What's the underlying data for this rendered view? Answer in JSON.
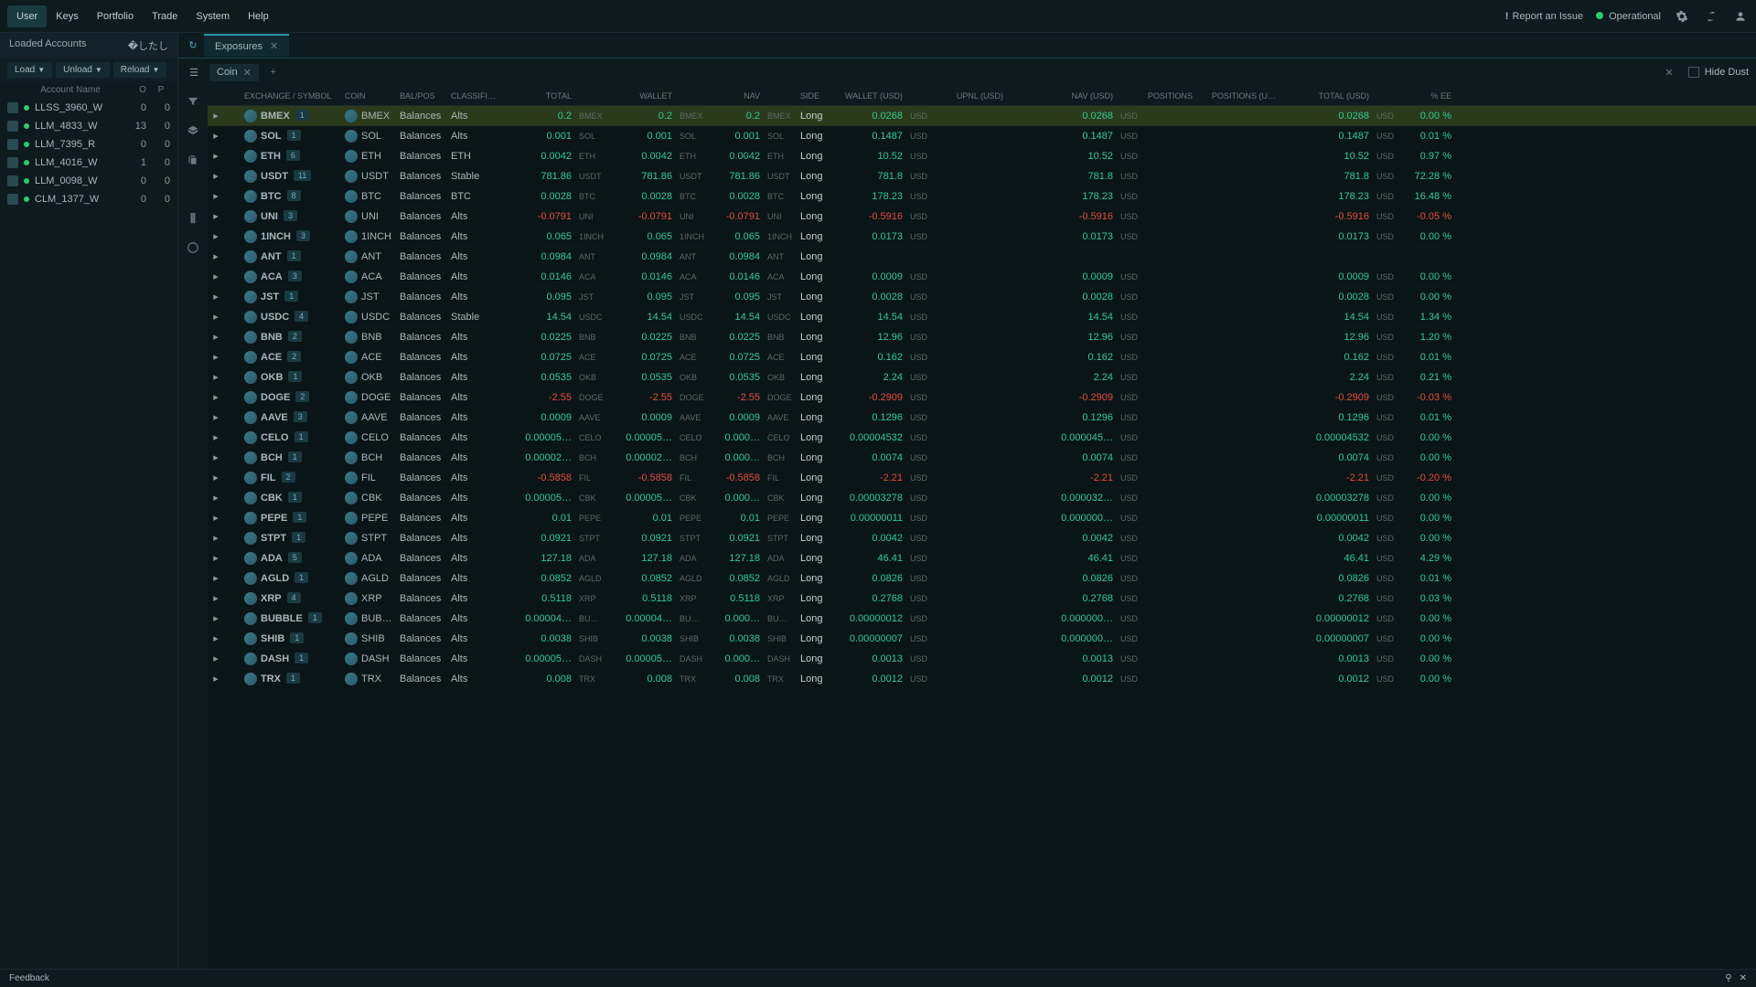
{
  "menu": {
    "items": [
      "User",
      "Keys",
      "Portfolio",
      "Trade",
      "System",
      "Help"
    ],
    "active": 0
  },
  "topbar": {
    "report": "Report an Issue",
    "status": "Operational"
  },
  "sidebar": {
    "title": "Loaded Accounts",
    "tools": [
      "Load",
      "Unload",
      "Reload"
    ],
    "cols": {
      "name": "Account Name",
      "o": "O",
      "p": "P"
    },
    "accounts": [
      {
        "name": "LLSS_3960_W",
        "o": 0,
        "p": 0
      },
      {
        "name": "LLM_4833_W",
        "o": 13,
        "p": 0
      },
      {
        "name": "LLM_7395_R",
        "o": 0,
        "p": 0
      },
      {
        "name": "LLM_4016_W",
        "o": 1,
        "p": 0
      },
      {
        "name": "LLM_0098_W",
        "o": 0,
        "p": 0
      },
      {
        "name": "CLM_1377_W",
        "o": 0,
        "p": 0
      }
    ]
  },
  "tab": {
    "name": "Exposures"
  },
  "filter": {
    "chip": "Coin",
    "hideDust": "Hide Dust"
  },
  "headers": [
    "",
    "",
    "EXCHANGE / SYMBOL",
    "COIN",
    "BAL/POS",
    "CLASSIFICATION",
    "TOTAL",
    "",
    "WALLET",
    "",
    "NAV",
    "",
    "SIDE",
    "WALLET (USD)",
    "",
    "UPNL (USD)",
    "",
    "NAV (USD)",
    "",
    "POSITIONS",
    "POSITIONS (USD)",
    "TOTAL (USD)",
    "",
    "% EE"
  ],
  "rows": [
    {
      "sym": "BMEX",
      "cnt": 1,
      "bal": "Balances",
      "cls": "Alts",
      "tot": "0.2",
      "wal": "0.2",
      "nav": "0.2",
      "side": "Long",
      "wusd": "0.0268",
      "navusd": "0.0268",
      "tusd": "0.0268",
      "ee": "0.00 %",
      "u": "BMEX",
      "sel": true
    },
    {
      "sym": "SOL",
      "cnt": 1,
      "bal": "Balances",
      "cls": "Alts",
      "tot": "0.001",
      "wal": "0.001",
      "nav": "0.001",
      "side": "Long",
      "wusd": "0.1487",
      "navusd": "0.1487",
      "tusd": "0.1487",
      "ee": "0.01 %",
      "u": "SOL"
    },
    {
      "sym": "ETH",
      "cnt": 6,
      "bal": "Balances",
      "cls": "ETH",
      "tot": "0.0042",
      "wal": "0.0042",
      "nav": "0.0042",
      "side": "Long",
      "wusd": "10.52",
      "navusd": "10.52",
      "tusd": "10.52",
      "ee": "0.97 %",
      "u": "ETH"
    },
    {
      "sym": "USDT",
      "cnt": 11,
      "bal": "Balances",
      "cls": "Stable",
      "tot": "781.86",
      "wal": "781.86",
      "nav": "781.86",
      "side": "Long",
      "wusd": "781.8",
      "navusd": "781.8",
      "tusd": "781.8",
      "ee": "72.28 %",
      "u": "USDT"
    },
    {
      "sym": "BTC",
      "cnt": 8,
      "bal": "Balances",
      "cls": "BTC",
      "tot": "0.0028",
      "wal": "0.0028",
      "nav": "0.0028",
      "side": "Long",
      "wusd": "178.23",
      "navusd": "178.23",
      "tusd": "178.23",
      "ee": "16.48 %",
      "u": "BTC"
    },
    {
      "sym": "UNI",
      "cnt": 3,
      "bal": "Balances",
      "cls": "Alts",
      "tot": "-0.0791",
      "wal": "-0.0791",
      "nav": "-0.0791",
      "side": "Long",
      "wusd": "-0.5916",
      "navusd": "-0.5916",
      "tusd": "-0.5916",
      "ee": "-0.05 %",
      "u": "UNI",
      "neg": true
    },
    {
      "sym": "1INCH",
      "cnt": 3,
      "bal": "Balances",
      "cls": "Alts",
      "tot": "0.065",
      "wal": "0.065",
      "nav": "0.065",
      "side": "Long",
      "wusd": "0.0173",
      "navusd": "0.0173",
      "tusd": "0.0173",
      "ee": "0.00 %",
      "u": "1INCH"
    },
    {
      "sym": "ANT",
      "cnt": 1,
      "bal": "Balances",
      "cls": "Alts",
      "tot": "0.0984",
      "wal": "0.0984",
      "nav": "0.0984",
      "side": "Long",
      "wusd": "",
      "navusd": "",
      "tusd": "",
      "ee": "",
      "u": "ANT"
    },
    {
      "sym": "ACA",
      "cnt": 3,
      "bal": "Balances",
      "cls": "Alts",
      "tot": "0.0146",
      "wal": "0.0146",
      "nav": "0.0146",
      "side": "Long",
      "wusd": "0.0009",
      "navusd": "0.0009",
      "tusd": "0.0009",
      "ee": "0.00 %",
      "u": "ACA"
    },
    {
      "sym": "JST",
      "cnt": 1,
      "bal": "Balances",
      "cls": "Alts",
      "tot": "0.095",
      "wal": "0.095",
      "nav": "0.095",
      "side": "Long",
      "wusd": "0.0028",
      "navusd": "0.0028",
      "tusd": "0.0028",
      "ee": "0.00 %",
      "u": "JST"
    },
    {
      "sym": "USDC",
      "cnt": 4,
      "bal": "Balances",
      "cls": "Stable",
      "tot": "14.54",
      "wal": "14.54",
      "nav": "14.54",
      "side": "Long",
      "wusd": "14.54",
      "navusd": "14.54",
      "tusd": "14.54",
      "ee": "1.34 %",
      "u": "USDC"
    },
    {
      "sym": "BNB",
      "cnt": 2,
      "bal": "Balances",
      "cls": "Alts",
      "tot": "0.0225",
      "wal": "0.0225",
      "nav": "0.0225",
      "side": "Long",
      "wusd": "12.96",
      "navusd": "12.96",
      "tusd": "12.96",
      "ee": "1.20 %",
      "u": "BNB"
    },
    {
      "sym": "ACE",
      "cnt": 2,
      "bal": "Balances",
      "cls": "Alts",
      "tot": "0.0725",
      "wal": "0.0725",
      "nav": "0.0725",
      "side": "Long",
      "wusd": "0.162",
      "navusd": "0.162",
      "tusd": "0.162",
      "ee": "0.01 %",
      "u": "ACE"
    },
    {
      "sym": "OKB",
      "cnt": 1,
      "bal": "Balances",
      "cls": "Alts",
      "tot": "0.0535",
      "wal": "0.0535",
      "nav": "0.0535",
      "side": "Long",
      "wusd": "2.24",
      "navusd": "2.24",
      "tusd": "2.24",
      "ee": "0.21 %",
      "u": "OKB"
    },
    {
      "sym": "DOGE",
      "cnt": 2,
      "bal": "Balances",
      "cls": "Alts",
      "tot": "-2.55",
      "wal": "-2.55",
      "nav": "-2.55",
      "side": "Long",
      "wusd": "-0.2909",
      "navusd": "-0.2909",
      "tusd": "-0.2909",
      "ee": "-0.03 %",
      "u": "DOGE",
      "neg": true
    },
    {
      "sym": "AAVE",
      "cnt": 3,
      "bal": "Balances",
      "cls": "Alts",
      "tot": "0.0009",
      "wal": "0.0009",
      "nav": "0.0009",
      "side": "Long",
      "wusd": "0.1296",
      "navusd": "0.1296",
      "tusd": "0.1296",
      "ee": "0.01 %",
      "u": "AAVE"
    },
    {
      "sym": "CELO",
      "cnt": 1,
      "bal": "Balances",
      "cls": "Alts",
      "tot": "0.00005…",
      "wal": "0.00005…",
      "nav": "0.000…",
      "side": "Long",
      "wusd": "0.00004532",
      "navusd": "0.000045…",
      "tusd": "0.00004532",
      "ee": "0.00 %",
      "u": "CELO"
    },
    {
      "sym": "BCH",
      "cnt": 1,
      "bal": "Balances",
      "cls": "Alts",
      "tot": "0.00002…",
      "wal": "0.00002…",
      "nav": "0.000…",
      "side": "Long",
      "wusd": "0.0074",
      "navusd": "0.0074",
      "tusd": "0.0074",
      "ee": "0.00 %",
      "u": "BCH"
    },
    {
      "sym": "FIL",
      "cnt": 2,
      "bal": "Balances",
      "cls": "Alts",
      "tot": "-0.5858",
      "wal": "-0.5858",
      "nav": "-0.5858",
      "side": "Long",
      "wusd": "-2.21",
      "navusd": "-2.21",
      "tusd": "-2.21",
      "ee": "-0.20 %",
      "u": "FIL",
      "neg": true
    },
    {
      "sym": "CBK",
      "cnt": 1,
      "bal": "Balances",
      "cls": "Alts",
      "tot": "0.00005…",
      "wal": "0.00005…",
      "nav": "0.000…",
      "side": "Long",
      "wusd": "0.00003278",
      "navusd": "0.000032…",
      "tusd": "0.00003278",
      "ee": "0.00 %",
      "u": "CBK"
    },
    {
      "sym": "PEPE",
      "cnt": 1,
      "bal": "Balances",
      "cls": "Alts",
      "tot": "0.01",
      "wal": "0.01",
      "nav": "0.01",
      "side": "Long",
      "wusd": "0.00000011",
      "navusd": "0.000000…",
      "tusd": "0.00000011",
      "ee": "0.00 %",
      "u": "PEPE"
    },
    {
      "sym": "STPT",
      "cnt": 1,
      "bal": "Balances",
      "cls": "Alts",
      "tot": "0.0921",
      "wal": "0.0921",
      "nav": "0.0921",
      "side": "Long",
      "wusd": "0.0042",
      "navusd": "0.0042",
      "tusd": "0.0042",
      "ee": "0.00 %",
      "u": "STPT"
    },
    {
      "sym": "ADA",
      "cnt": 5,
      "bal": "Balances",
      "cls": "Alts",
      "tot": "127.18",
      "wal": "127.18",
      "nav": "127.18",
      "side": "Long",
      "wusd": "46.41",
      "navusd": "46.41",
      "tusd": "46.41",
      "ee": "4.29 %",
      "u": "ADA"
    },
    {
      "sym": "AGLD",
      "cnt": 1,
      "bal": "Balances",
      "cls": "Alts",
      "tot": "0.0852",
      "wal": "0.0852",
      "nav": "0.0852",
      "side": "Long",
      "wusd": "0.0826",
      "navusd": "0.0826",
      "tusd": "0.0826",
      "ee": "0.01 %",
      "u": "AGLD"
    },
    {
      "sym": "XRP",
      "cnt": 4,
      "bal": "Balances",
      "cls": "Alts",
      "tot": "0.5118",
      "wal": "0.5118",
      "nav": "0.5118",
      "side": "Long",
      "wusd": "0.2768",
      "navusd": "0.2768",
      "tusd": "0.2768",
      "ee": "0.03 %",
      "u": "XRP"
    },
    {
      "sym": "BUBBLE",
      "cnt": 1,
      "bal": "Balances",
      "cls": "Alts",
      "tot": "0.00004…",
      "wal": "0.00004…",
      "nav": "0.000…",
      "side": "Long",
      "wusd": "0.00000012",
      "navusd": "0.000000…",
      "tusd": "0.00000012",
      "ee": "0.00 %",
      "u": "BU…",
      "coin": "BUBB…"
    },
    {
      "sym": "SHIB",
      "cnt": 1,
      "bal": "Balances",
      "cls": "Alts",
      "tot": "0.0038",
      "wal": "0.0038",
      "nav": "0.0038",
      "side": "Long",
      "wusd": "0.00000007",
      "navusd": "0.000000…",
      "tusd": "0.00000007",
      "ee": "0.00 %",
      "u": "SHIB"
    },
    {
      "sym": "DASH",
      "cnt": 1,
      "bal": "Balances",
      "cls": "Alts",
      "tot": "0.00005…",
      "wal": "0.00005…",
      "nav": "0.000…",
      "side": "Long",
      "wusd": "0.0013",
      "navusd": "0.0013",
      "tusd": "0.0013",
      "ee": "0.00 %",
      "u": "DASH"
    },
    {
      "sym": "TRX",
      "cnt": 1,
      "bal": "Balances",
      "cls": "Alts",
      "tot": "0.008",
      "wal": "0.008",
      "nav": "0.008",
      "side": "Long",
      "wusd": "0.0012",
      "navusd": "0.0012",
      "tusd": "0.0012",
      "ee": "0.00 %",
      "u": "TRX"
    }
  ],
  "footer": {
    "feedback": "Feedback"
  }
}
